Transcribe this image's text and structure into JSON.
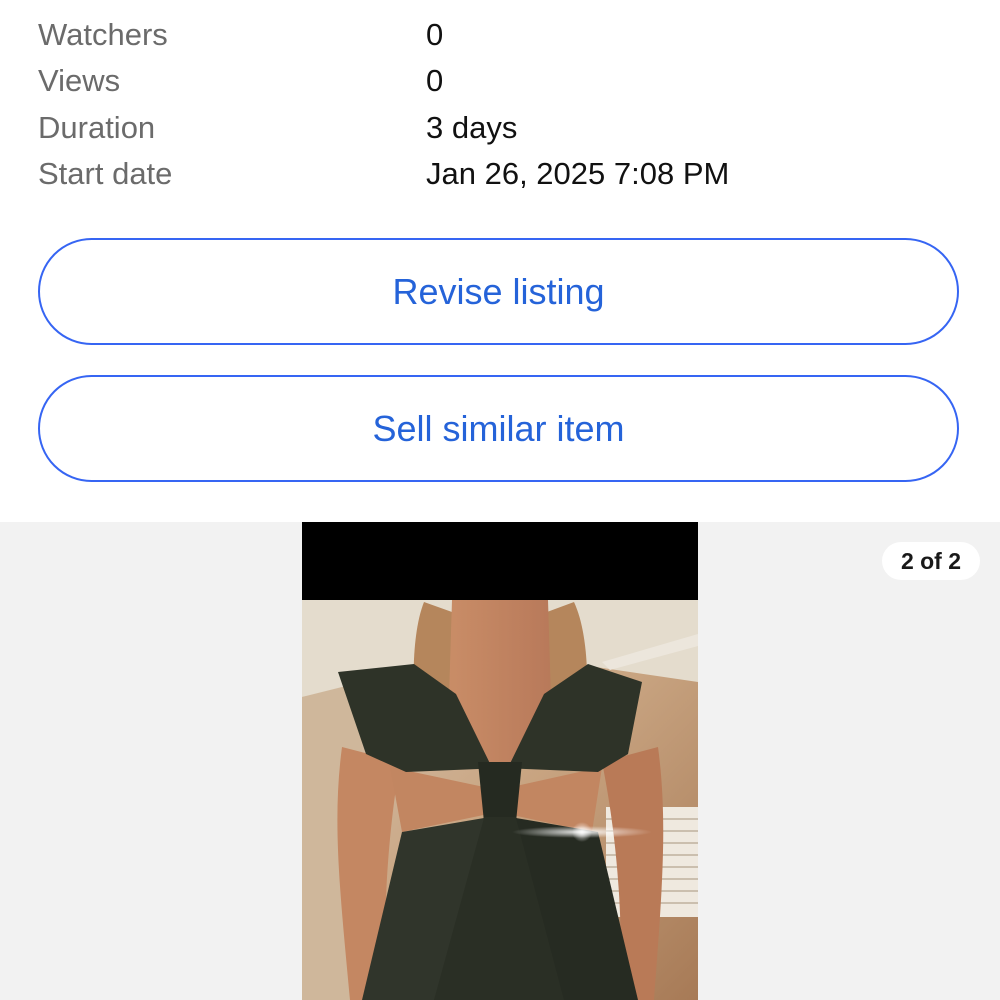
{
  "details": [
    {
      "label": "Watchers",
      "value": "0"
    },
    {
      "label": "Views",
      "value": "0"
    },
    {
      "label": "Duration",
      "value": "3 days"
    },
    {
      "label": "Start date",
      "value": "Jan 26, 2025 7:08 PM"
    }
  ],
  "actions": {
    "revise_label": "Revise listing",
    "sell_similar_label": "Sell similar item"
  },
  "gallery": {
    "counter": "2 of 2",
    "photo_icon": "dress-photo"
  },
  "colors": {
    "accent": "#3665f3",
    "button_text": "#2563d9",
    "label_text": "#6b6b6b",
    "gallery_bg": "#f2f2f2"
  }
}
